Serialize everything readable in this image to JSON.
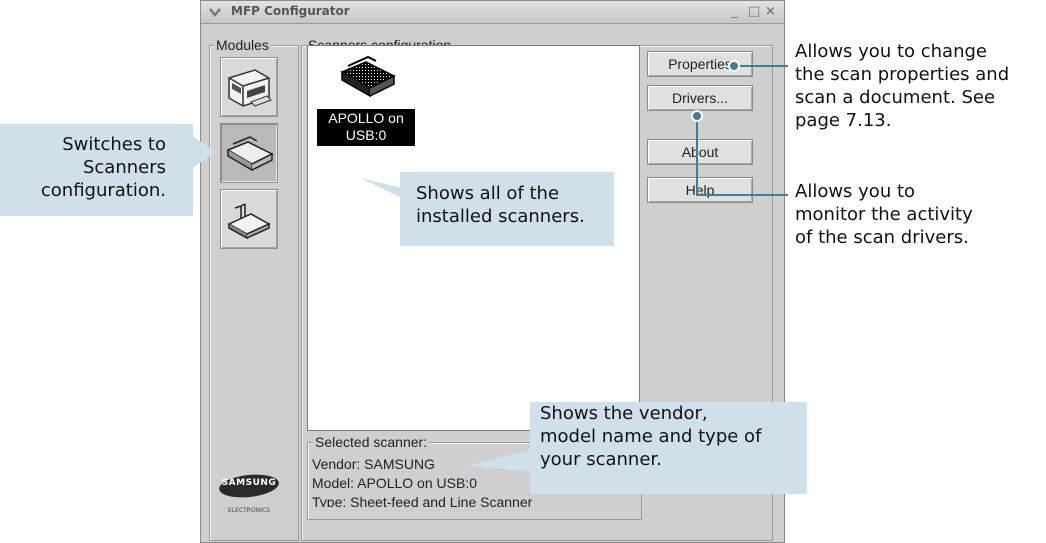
{
  "window": {
    "title": "MFP Configurator",
    "controls": {
      "minimize": "_",
      "maximize": "□",
      "close": "×"
    }
  },
  "modules": {
    "group_label": "Modules",
    "buttons": [
      {
        "name": "printer-module",
        "icon": "printer-icon",
        "selected": false
      },
      {
        "name": "scanner-module",
        "icon": "scanner-icon",
        "selected": true
      },
      {
        "name": "port-module",
        "icon": "port-icon",
        "selected": false
      }
    ],
    "brand": "SAMSUNG",
    "brand_sub": "ELECTRONICS"
  },
  "scanners": {
    "group_label": "Scanners configuration",
    "items": [
      {
        "label_line1": "APOLLO on",
        "label_line2": "USB:0",
        "icon": "scanner-icon"
      }
    ]
  },
  "actions": {
    "properties": "Properties",
    "drivers": "Drivers...",
    "about": "About",
    "help": "Help"
  },
  "selected_scanner": {
    "group_label": "Selected scanner:",
    "vendor": "Vendor: SAMSUNG",
    "model": "Model: APOLLO on USB:0",
    "type": "Type: Sheet-feed and Line Scanner"
  },
  "annotations": {
    "switches": [
      "Switches to",
      "Scanners",
      "configuration."
    ],
    "shows_installed": [
      "Shows all of the",
      "installed scanners."
    ],
    "properties_note": [
      "Allows you to change",
      "the scan properties and",
      "scan a document. See",
      "page 7.13."
    ],
    "drivers_note": [
      "Allows you to",
      "monitor the activity",
      "of the scan drivers."
    ],
    "selected_note": [
      "Shows the vendor,",
      "model name and type of",
      "your scanner."
    ]
  },
  "colors": {
    "callout_bg": "#cfe0ea",
    "leader": "#3c7f98",
    "window_bg": "#cfcfcf"
  }
}
